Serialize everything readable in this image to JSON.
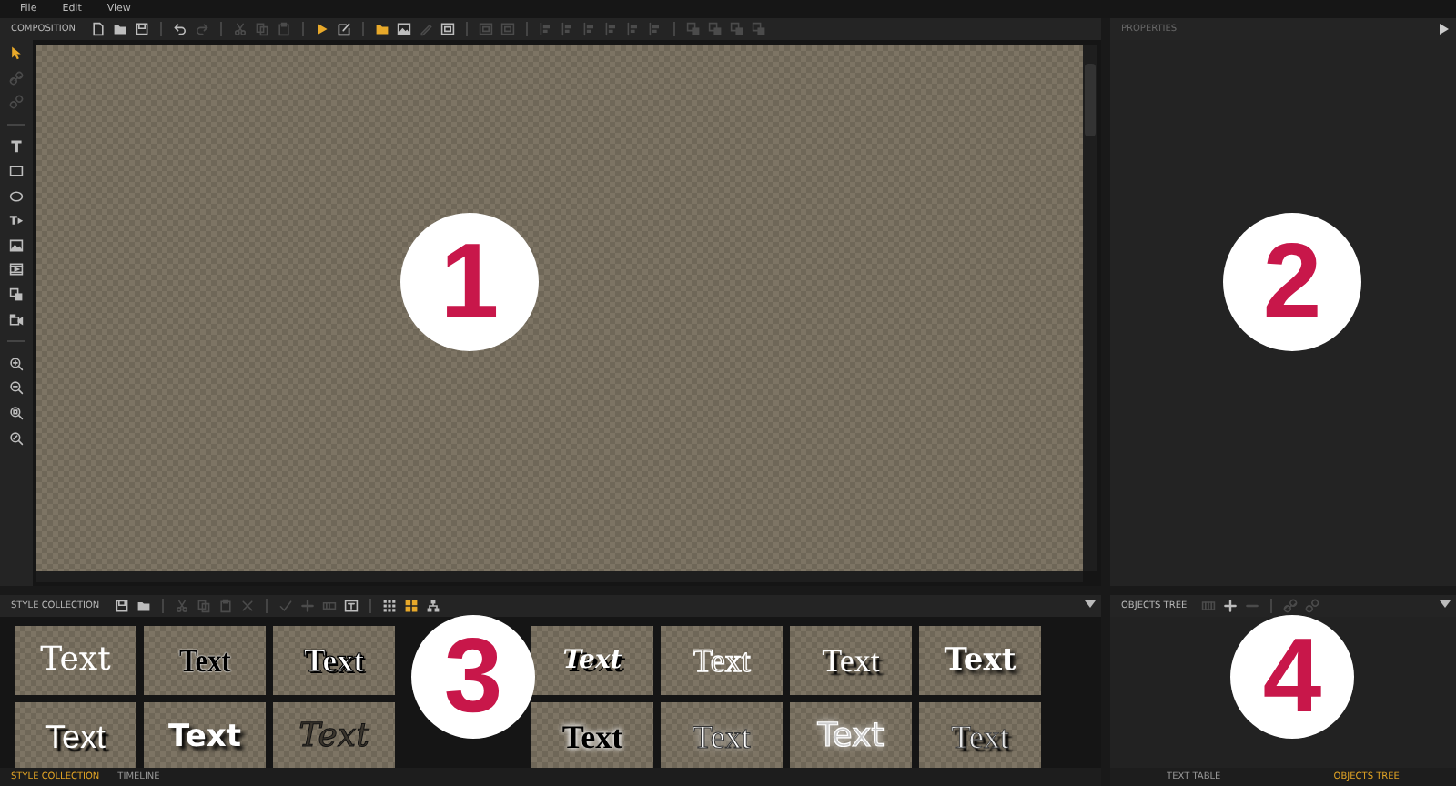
{
  "menu": [
    "File",
    "Edit",
    "View"
  ],
  "composition": {
    "title": "COMPOSITION",
    "tools": [
      {
        "disabled": false,
        "selected": false
      },
      {
        "disabled": false,
        "selected": false
      },
      {
        "disabled": false,
        "selected": false
      },
      {
        "disabled": false,
        "selected": false
      },
      {
        "disabled": true,
        "selected": false
      },
      {
        "disabled": true,
        "selected": false
      },
      {
        "disabled": true,
        "selected": false
      },
      {
        "disabled": true,
        "selected": false
      },
      {
        "disabled": false,
        "selected": true
      },
      {
        "disabled": false,
        "selected": false
      },
      {
        "disabled": false,
        "selected": true
      },
      {
        "disabled": false,
        "selected": false
      },
      {
        "disabled": true,
        "selected": false
      },
      {
        "disabled": false,
        "selected": false
      },
      {
        "disabled": true,
        "selected": false
      },
      {
        "disabled": true,
        "selected": false
      },
      {
        "disabled": true,
        "selected": false
      },
      {
        "disabled": true,
        "selected": false
      },
      {
        "disabled": true,
        "selected": false
      },
      {
        "disabled": true,
        "selected": false
      },
      {
        "disabled": true,
        "selected": false
      },
      {
        "disabled": true,
        "selected": false
      },
      {
        "disabled": true,
        "selected": false
      },
      {
        "disabled": true,
        "selected": false
      },
      {
        "disabled": true,
        "selected": false
      },
      {
        "disabled": true,
        "selected": false
      }
    ],
    "side_tools": [
      {
        "disabled": false,
        "selected": true
      },
      {
        "disabled": true,
        "selected": false
      },
      {
        "disabled": true,
        "selected": false
      },
      {
        "disabled": false,
        "selected": false
      },
      {
        "disabled": false,
        "selected": false
      },
      {
        "disabled": false,
        "selected": false
      },
      {
        "disabled": false,
        "selected": false
      },
      {
        "disabled": false,
        "selected": false
      },
      {
        "disabled": false,
        "selected": false
      },
      {
        "disabled": false,
        "selected": false
      },
      {
        "disabled": false,
        "selected": false
      },
      {
        "disabled": false,
        "selected": false
      },
      {
        "disabled": false,
        "selected": false
      },
      {
        "disabled": false,
        "selected": false
      },
      {
        "disabled": false,
        "selected": false
      }
    ]
  },
  "properties": {
    "title": "PROPERTIES"
  },
  "style_collection": {
    "title": "STYLE COLLECTION",
    "tools": [
      {
        "disabled": false,
        "selected": false
      },
      {
        "disabled": false,
        "selected": false
      },
      {
        "disabled": true,
        "selected": false
      },
      {
        "disabled": true,
        "selected": false
      },
      {
        "disabled": true,
        "selected": false
      },
      {
        "disabled": true,
        "selected": false
      },
      {
        "disabled": true,
        "selected": false
      },
      {
        "disabled": true,
        "selected": false
      },
      {
        "disabled": true,
        "selected": false
      },
      {
        "disabled": false,
        "selected": false
      },
      {
        "disabled": false,
        "selected": false
      },
      {
        "disabled": false,
        "selected": true
      },
      {
        "disabled": false,
        "selected": false
      }
    ],
    "styles": [
      {
        "label": "Text",
        "kind": "serif-light"
      },
      {
        "label": "Text",
        "kind": "condensed-black"
      },
      {
        "label": "Text",
        "kind": "condensed-white"
      },
      {
        "kind": "covered"
      },
      {
        "label": "Text",
        "kind": "italic-shadow"
      },
      {
        "label": "Text",
        "kind": "serif-outline"
      },
      {
        "label": "Text",
        "kind": "serif-shadow"
      },
      {
        "label": "Text",
        "kind": "bold-shadow"
      },
      {
        "label": "Text",
        "kind": "sans-shadow"
      },
      {
        "label": "Text",
        "kind": "sans-bold"
      },
      {
        "label": "Text",
        "kind": "dark-outline"
      },
      {
        "kind": "covered"
      },
      {
        "label": "Text",
        "kind": "condensed-glow"
      },
      {
        "label": "Text",
        "kind": "torn"
      },
      {
        "label": "Text",
        "kind": "white-glow"
      },
      {
        "label": "Text",
        "kind": "dark-shadow"
      }
    ]
  },
  "objects_tree": {
    "title": "OBJECTS TREE",
    "tools": [
      {
        "disabled": true,
        "selected": false
      },
      {
        "disabled": false,
        "selected": false
      },
      {
        "disabled": true,
        "selected": false
      },
      {
        "disabled": true,
        "selected": false
      },
      {
        "disabled": true,
        "selected": false
      }
    ]
  },
  "bottom_tabs_left": [
    {
      "label": "STYLE COLLECTION",
      "selected": true
    },
    {
      "label": "TIMELINE",
      "selected": false
    }
  ],
  "bottom_tabs_right": [
    {
      "label": "TEXT TABLE",
      "selected": false
    },
    {
      "label": "OBJECTS TREE",
      "selected": true
    }
  ],
  "callouts": [
    "1",
    "2",
    "3",
    "4"
  ]
}
